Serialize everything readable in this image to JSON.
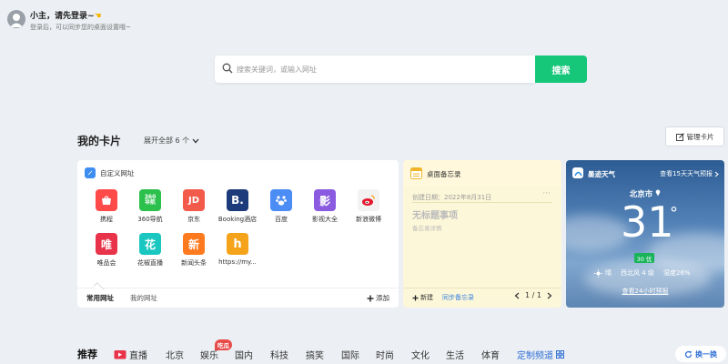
{
  "user": {
    "title": "小主，请先登录~",
    "subtitle": "登录后，可以同步您的桌面设置哦~"
  },
  "search": {
    "placeholder": "搜索关键词，或输入网址",
    "value": "",
    "button_label": "搜索"
  },
  "cards": {
    "title": "我的卡片",
    "expand_label": "展开全部 6 个",
    "manage_label": "管理卡片"
  },
  "shortcut_card": {
    "title": "自定义网址",
    "sites": [
      {
        "name": "携程",
        "glyph": "",
        "color": "#ff4a4a"
      },
      {
        "name": "360导航",
        "glyph": "360\n导航",
        "color": "#2cc04c"
      },
      {
        "name": "京东",
        "glyph": "JD",
        "color": "#f25a4a"
      },
      {
        "name": "Booking酒店",
        "glyph": "B.",
        "color": "#1c3b7a"
      },
      {
        "name": "百度",
        "glyph": "",
        "color": "#4b8cf5"
      },
      {
        "name": "影视大全",
        "glyph": "影",
        "color": "#8a5be0"
      },
      {
        "name": "新浪微博",
        "glyph": "",
        "color": "#f2f2f2"
      },
      {
        "name": "唯品会",
        "glyph": "唯",
        "color": "#e8334a"
      },
      {
        "name": "花椒直播",
        "glyph": "花",
        "color": "#1ac7c0"
      },
      {
        "name": "新闻头条",
        "glyph": "新",
        "color": "#ff7a1f"
      },
      {
        "name": "https://my...",
        "glyph": "h",
        "color": "#f5a31a"
      }
    ],
    "tab_common": "常用网址",
    "tab_mine": "我的网址",
    "add_label": "添加"
  },
  "memo_card": {
    "title": "桌面备忘录",
    "date": "创建日期：2022年8月31日",
    "dots": "···",
    "note_title": "无标题事项",
    "note_detail": "备忘录详情",
    "new_label": "新建",
    "sync_label": "同步备忘录",
    "page": "1 / 1"
  },
  "weather_card": {
    "brand": "墨迹天气",
    "forecast_link": "查看15天天气预报",
    "city": "北京市",
    "temperature": "31",
    "degree": "°",
    "aqi": "30 优",
    "condition": "晴",
    "wind": "西北风 4 级",
    "humidity": "湿度26%",
    "hourly_link": "查看24小时预报"
  },
  "news_nav": {
    "items": [
      "推荐",
      "直播",
      "北京",
      "娱乐",
      "国内",
      "科技",
      "搞笑",
      "国际",
      "时尚",
      "文化",
      "生活",
      "体育",
      "定制频道"
    ],
    "hot_badge": "吃瓜",
    "refresh_label": "换一换"
  },
  "colors": {
    "accent_green": "#16c77a",
    "link_blue": "#2f6fd6",
    "background": "#eceff3"
  }
}
